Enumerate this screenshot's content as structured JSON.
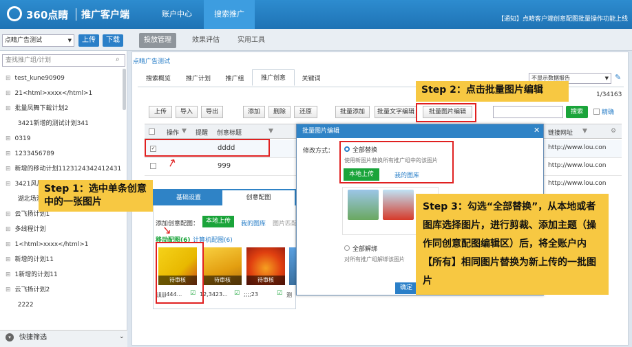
{
  "app": {
    "logo": "360点睛",
    "subtitle": "推广客户端",
    "top_tabs": [
      "账户中心",
      "搜索推广"
    ],
    "notice": "【通知】点睛客户端创意配图批量操作功能上线"
  },
  "toolbar": {
    "account": "点睛广告测试",
    "upload": "上传",
    "download": "下载",
    "nav": [
      "投放管理",
      "效果评估",
      "实用工具"
    ]
  },
  "sidebar": {
    "search_placeholder": "查找推广组/计划",
    "items": [
      "test_kune90909",
      "21<html>xxxx</html>1",
      "批量凤舞下载计划2",
      "3421新增的测试计划341",
      "0319",
      "1233456789",
      "新增的移动计划1123124342412431",
      "3421风风火火1",
      "湖北场测试标4441",
      "云飞扬计划1",
      "多线程计划",
      "1<html>xxxx</html>1",
      "新增的计划11",
      "1新增的计划11",
      "云飞扬计划2",
      "2222"
    ],
    "footer": "快捷筛选"
  },
  "main": {
    "breadcrumb": "点睛广告测试",
    "tabs": [
      "搜索概览",
      "推广计划",
      "推广组",
      "推广创意",
      "关键词"
    ],
    "report_select": "不显示数据报告",
    "count": "1/34163",
    "buttons": [
      "上传",
      "导入",
      "导出",
      "添加",
      "删除",
      "还原",
      "批量添加",
      "批量文字编辑",
      "批量图片编辑"
    ],
    "search_btn": "搜索",
    "exact": "精确",
    "headers": [
      "操作",
      "提醒",
      "创意标题",
      "链接网址"
    ],
    "rows": [
      {
        "title": "dddd",
        "url": "http://www.lou.con"
      },
      {
        "title": "999",
        "url": "http://www.lou.con"
      },
      {
        "title": "",
        "url": "http://www.lou.con"
      }
    ]
  },
  "bottom_panel": {
    "tabs": [
      "基础设置",
      "创意配图"
    ],
    "add_label": "添加创意配图：",
    "local_upload": "本地上传",
    "my_library": "我的图库",
    "match": "图片匹配",
    "mobile_tab": "移动配图(6)",
    "pc_tab": "计算机配图(6)",
    "pending": "待审核",
    "captions": [
      "jjjjjj444...",
      "12,3423...",
      ";;;;23",
      "测"
    ]
  },
  "modal": {
    "title": "批量图片编辑",
    "label": "修改方式：",
    "opt1": "全部替换",
    "opt1_desc": "使用新图片替换所有推广组中的该图片",
    "local_upload": "本地上传",
    "my_library": "我的图库",
    "opt2": "全部解绑",
    "opt2_desc": "对所有推广组解绑该图片",
    "confirm": "确定"
  },
  "steps": {
    "s1": "Step 1：选中单条创意中的一张图片",
    "s2": "Step 2：点击批量图片编辑",
    "s3": "Step 3：勾选“全部替换”，从本地或者图库选择图片，进行剪裁、添加主题（操作同创意配图编辑区）后，将全账户内【所有】相同图片替换为新上传的一批图片"
  },
  "colors": {
    "brand_blue": "#2a7fc8",
    "green": "#1aa43a",
    "annotation": "#f7c842",
    "highlight": "#e02020"
  }
}
